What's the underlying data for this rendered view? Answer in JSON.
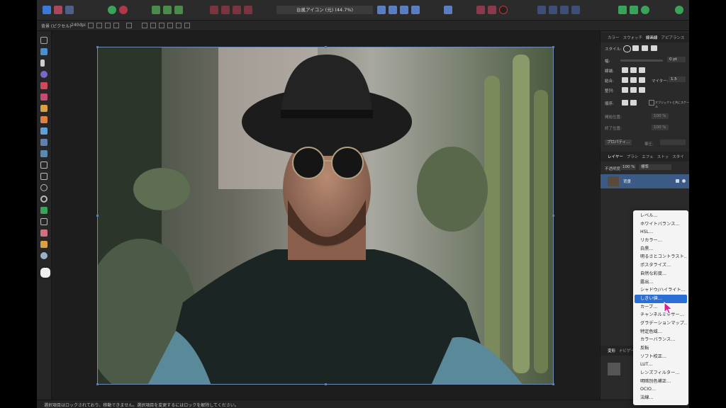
{
  "document": {
    "title": "台風アイコン (元) (44.7%)"
  },
  "context": {
    "layer_label": "背景 (ピクセル)",
    "dpi": "240dpi"
  },
  "panel": {
    "tabs": [
      "カラー",
      "スウォッチ",
      "線画線",
      "アピアランス"
    ],
    "style_label": "スタイル:",
    "width_label": "幅:",
    "width_value": "0 pt",
    "cap_label": "線端:",
    "join_label": "結合:",
    "miter_label": "マイター:",
    "miter_value": "1.5",
    "align_label": "整列:",
    "order_label": "順序:",
    "scale_check": "オブジェクトと共にスケール",
    "start_arrow": "開始位置:",
    "end_arrow": "終了位置:",
    "arrow_pct_1": "100 %",
    "arrow_pct_2": "100 %",
    "properties_button": "プロパティ…",
    "pressure_label": "筆圧:",
    "layers_tabs": [
      "レイヤー",
      "ブラシ",
      "エフェ",
      "ストッ",
      "スタイ"
    ],
    "opacity_label": "不透明度:",
    "opacity_value": "100 %",
    "blend_mode": "標準",
    "layer_name": "背景",
    "transform_tabs": [
      "変形",
      "ナビゲー"
    ]
  },
  "menu": {
    "items": [
      "レベル…",
      "ホワイトバランス…",
      "HSL…",
      "リカラー…",
      "白黒…",
      "明るさとコントラスト…",
      "ポスタライズ…",
      "自然な彩度…",
      "露出…",
      "シャドウ/ハイライト…",
      "しきい値…",
      "カーブ…",
      "チャンネルミキサー…",
      "グラデーションマップ…",
      "特定色域…",
      "カラーバランス…",
      "反転",
      "ソフト校正…",
      "LUT…",
      "レンズフィルター…",
      "明暗別色補正…",
      "OCIO…",
      "法線…"
    ],
    "selected_index": 10
  },
  "status": {
    "text": "選択項目はロックされており、移動できません。選択項目を変更するにはロックを解除してください。"
  },
  "colors": {
    "accent": "#2a6fd6",
    "layer_highlight": "#3b5a85",
    "app_bg": "#1f1f1f",
    "cursor": "#e0189a"
  }
}
